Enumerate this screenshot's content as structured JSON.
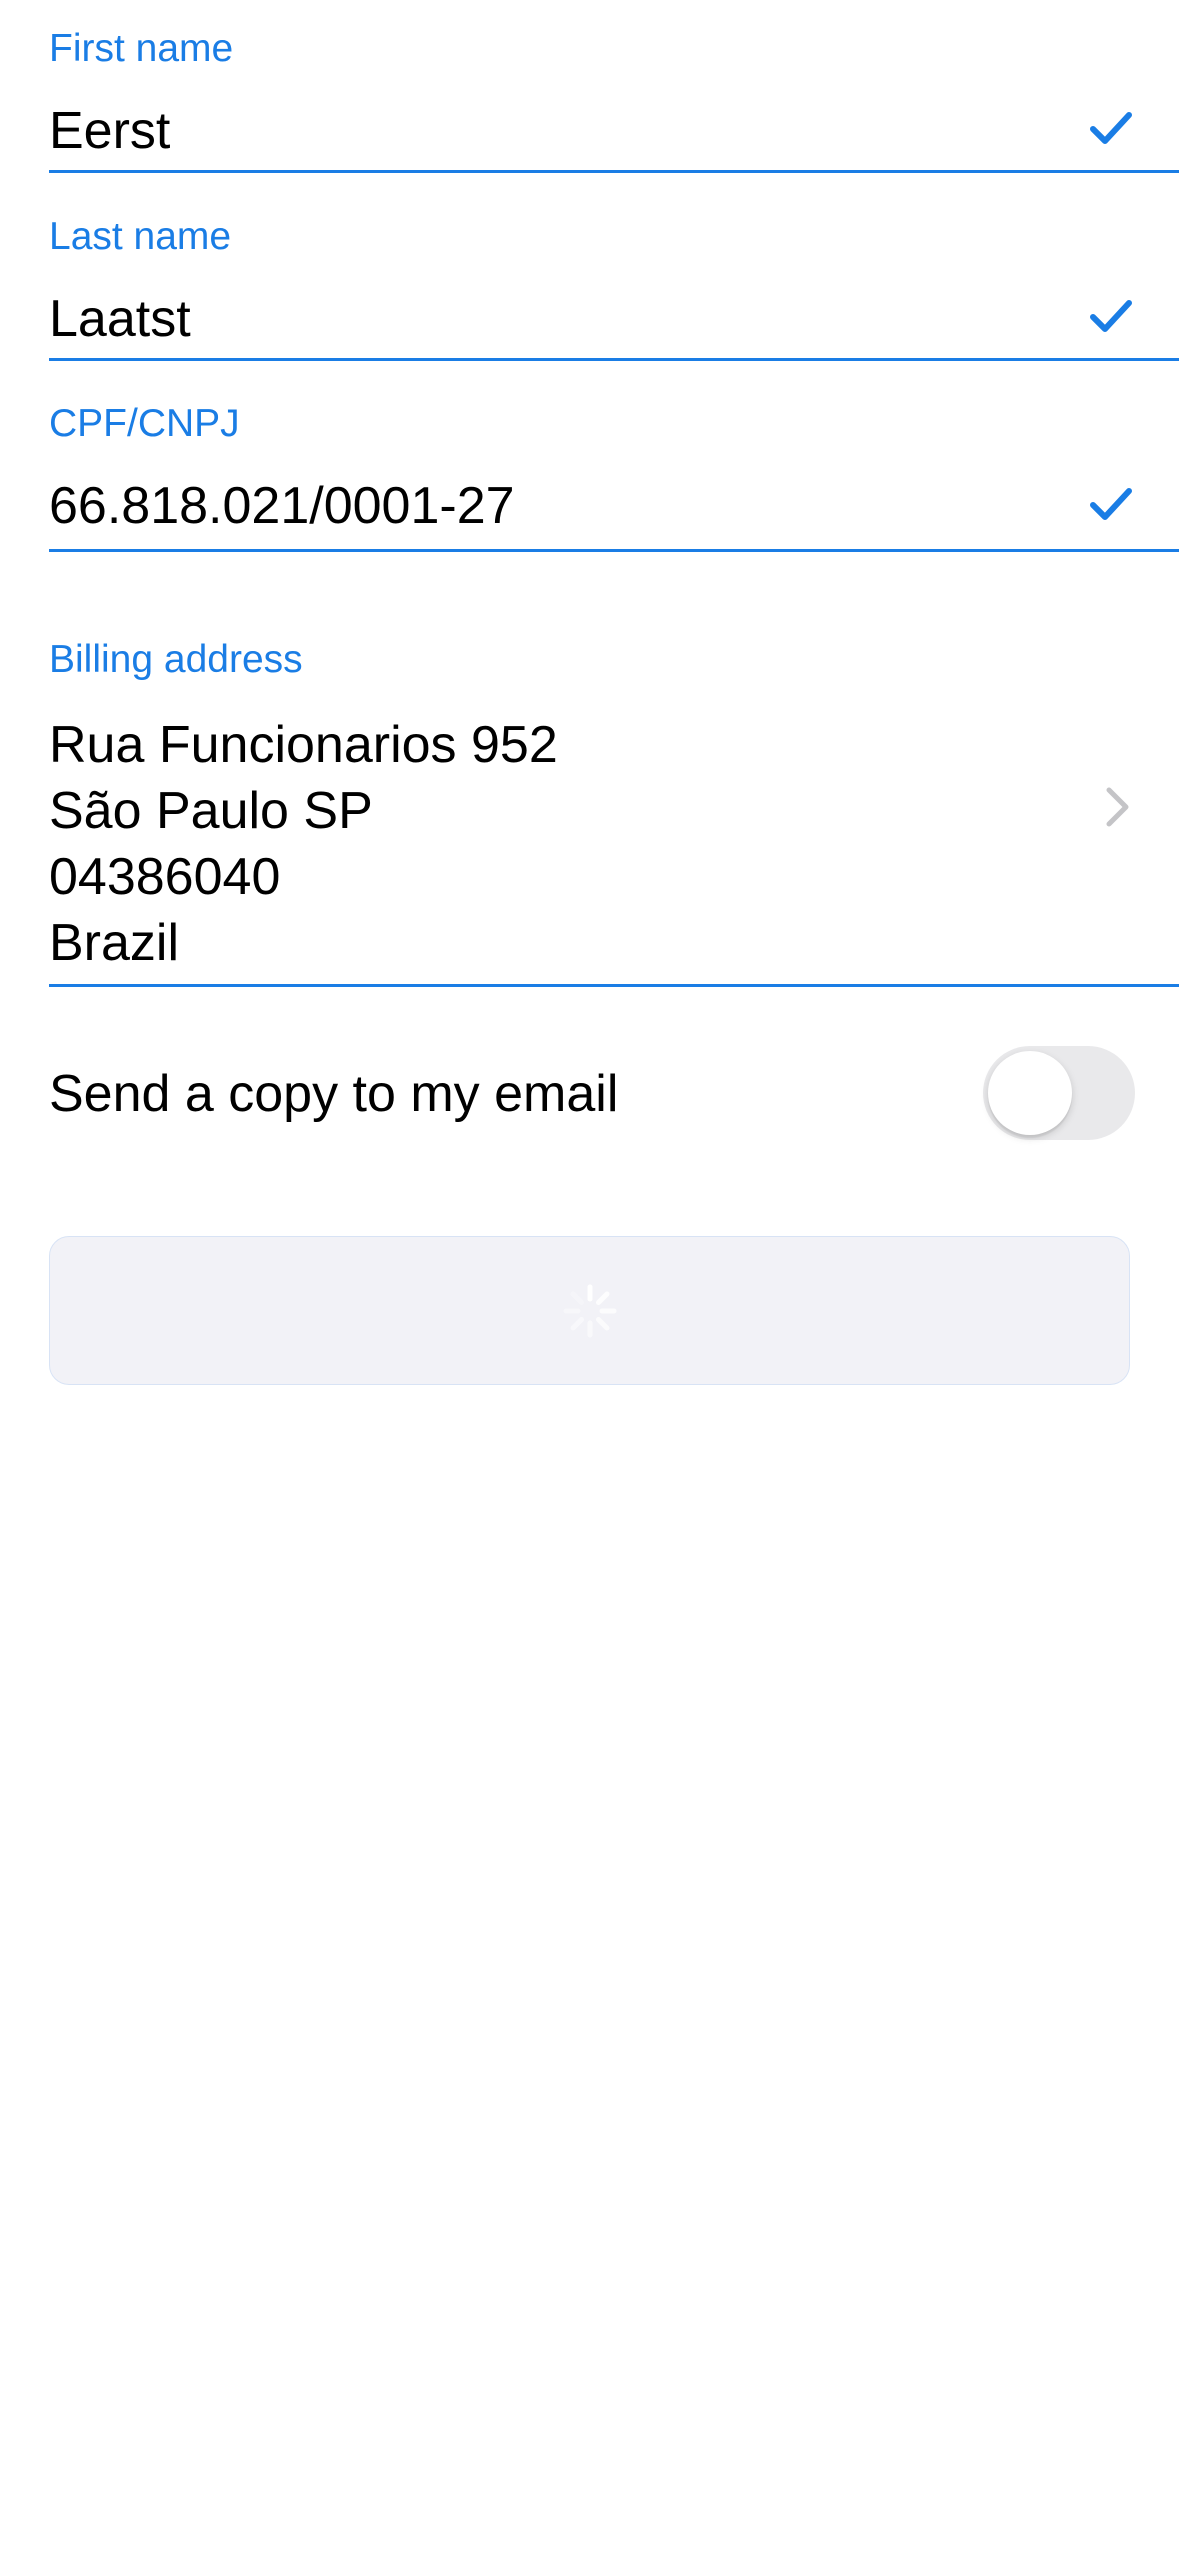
{
  "form": {
    "first_name": {
      "label": "First name",
      "value": "Eerst",
      "valid_icon": "checkmark-icon"
    },
    "last_name": {
      "label": "Last name",
      "value": "Laatst",
      "valid_icon": "checkmark-icon"
    },
    "tax_id": {
      "label": "CPF/CNPJ",
      "value": "66.818.021/0001-27",
      "valid_icon": "checkmark-icon"
    },
    "billing_address": {
      "label": "Billing address",
      "lines": [
        "Rua Funcionarios 952",
        "São Paulo SP",
        "04386040",
        "Brazil"
      ],
      "action_icon": "chevron-right-icon"
    },
    "email_copy": {
      "label": "Send a copy to my email",
      "enabled": false
    },
    "submit": {
      "state": "loading",
      "icon": "activity-spinner-icon"
    }
  },
  "colors": {
    "accent": "#1a7de5",
    "text": "#000000",
    "toggle_off": "#e9e9eb",
    "button_disabled_bg": "#f2f2f7",
    "chevron": "#c4c4c7"
  }
}
